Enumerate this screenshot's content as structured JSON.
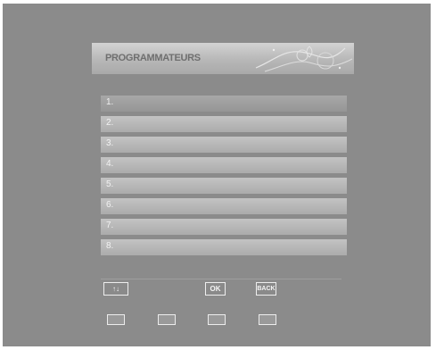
{
  "title": "PROGRAMMATEURS",
  "timers": [
    {
      "index": "1."
    },
    {
      "index": "2."
    },
    {
      "index": "3."
    },
    {
      "index": "4."
    },
    {
      "index": "5."
    },
    {
      "index": "6."
    },
    {
      "index": "7."
    },
    {
      "index": "8."
    }
  ],
  "hints": {
    "navigate_glyph": "↑↓",
    "ok_label": "OK",
    "back_label": "BACK"
  },
  "color_keys": [
    "red-key",
    "green-key",
    "yellow-key",
    "blue-key"
  ],
  "colors": {
    "screen_background": "#8b8b8b",
    "row_background": "#b7b7b7",
    "row_selected": "#9f9f9f"
  }
}
